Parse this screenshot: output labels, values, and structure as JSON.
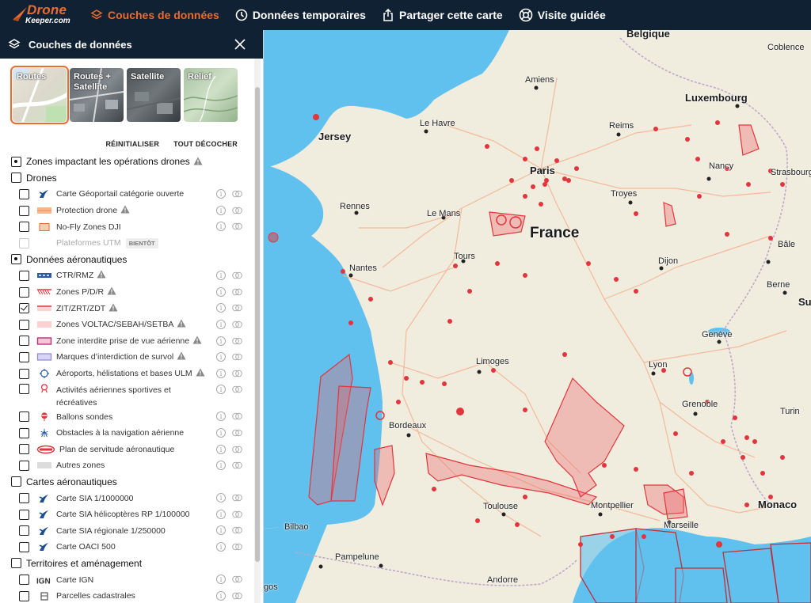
{
  "nav": {
    "logo_main": "Drone",
    "logo_sub": "Keeper.com",
    "items": [
      {
        "label": "Couches de données",
        "icon": "layers-icon",
        "active": true
      },
      {
        "label": "Données temporaires",
        "icon": "clock-icon",
        "active": false
      },
      {
        "label": "Partager cette carte",
        "icon": "share-icon",
        "active": false
      },
      {
        "label": "Visite guidée",
        "icon": "lifebuoy-icon",
        "active": false
      }
    ]
  },
  "panel": {
    "title": "Couches de données",
    "basemaps": [
      {
        "label": "Routes",
        "selected": true
      },
      {
        "label": "Routes + Satellite",
        "selected": false
      },
      {
        "label": "Satellite",
        "selected": false
      },
      {
        "label": "Relief",
        "selected": false
      }
    ],
    "reset_label": "RÉINITIALISER",
    "uncheck_all_label": "TOUT DÉCOCHER",
    "sections": [
      {
        "label": "Zones impactant les opérations drones",
        "state": "partial",
        "warn": true,
        "items": []
      },
      {
        "label": "Drones",
        "state": "off",
        "items": [
          {
            "label": "Carte Géoportail catégorie ouverte",
            "symbol": "plane-icon"
          },
          {
            "label": "Protection drone",
            "symbol": "orange-band",
            "warn": true
          },
          {
            "label": "No-Fly Zones DJI",
            "symbol": "orange-square"
          },
          {
            "label": "Plateformes UTM",
            "symbol": "none",
            "disabled": true,
            "tag": "BIENTÔT"
          }
        ]
      },
      {
        "label": "Données aéronautiques",
        "state": "partial",
        "items": [
          {
            "label": "CTR/RMZ",
            "symbol": "blue-dash",
            "warn": true
          },
          {
            "label": "Zones P/D/R",
            "symbol": "red-hatch",
            "warn": true
          },
          {
            "label": "ZIT/ZRT/ZDT",
            "symbol": "red-line",
            "warn": true,
            "checked": true
          },
          {
            "label": "Zones VOLTAC/SEBAH/SETBA",
            "symbol": "pink-fill",
            "warn": true
          },
          {
            "label": "Zone interdite prise de vue aérienne",
            "symbol": "magenta-box",
            "warn": true
          },
          {
            "label": "Marques d’interdiction de survol",
            "symbol": "lavender-box",
            "warn": true
          },
          {
            "label": "Aéroports, hélistations et bases ULM",
            "symbol": "airport-icon",
            "warn": true
          },
          {
            "label": "Activités aériennes sportives et récréatives",
            "symbol": "pin-icon",
            "tall": true
          },
          {
            "label": "Ballons sondes",
            "symbol": "balloon-icon"
          },
          {
            "label": "Obstacles à la navigation aérienne",
            "symbol": "obstacle-icon"
          },
          {
            "label": "Plan de servitude aéronautique",
            "symbol": "servitude-icon"
          },
          {
            "label": "Autres zones",
            "symbol": "gray-box"
          }
        ]
      },
      {
        "label": "Cartes aéronautiques",
        "state": "off",
        "items": [
          {
            "label": "Carte SIA 1/1000000",
            "symbol": "plane-icon"
          },
          {
            "label": "Carte SIA hélicoptères RP 1/100000",
            "symbol": "plane-icon"
          },
          {
            "label": "Carte SIA régionale 1/250000",
            "symbol": "plane-icon"
          },
          {
            "label": "Carte OACI 500",
            "symbol": "plane-icon"
          }
        ]
      },
      {
        "label": "Territoires et aménagement",
        "state": "off",
        "items": [
          {
            "label": "Carte IGN",
            "symbol": "ign-logo"
          },
          {
            "label": "Parcelles cadastrales",
            "symbol": "cadastre-icon"
          }
        ]
      }
    ]
  },
  "map": {
    "country_label": "France",
    "labels": [
      "Belgique",
      "Coblence",
      "Amiens",
      "Luxembourg",
      "Jersey",
      "Le Havre",
      "Reims",
      "Paris",
      "Nancy",
      "Strasbourg",
      "Troyes",
      "Rennes",
      "Le Mans",
      "Tours",
      "Dijon",
      "Bâle",
      "Nantes",
      "Berne",
      "Su",
      "Genève",
      "Limoges",
      "Lyon",
      "Grenoble",
      "Turin",
      "Bordeaux",
      "Montpellier",
      "Toulouse",
      "Monaco",
      "Marseille",
      "Bilbao",
      "Pampelune",
      "Andorre",
      "gos"
    ],
    "colors": {
      "water": "#60c1ef",
      "land": "#f0ecde",
      "zone_stroke": "#e2353d",
      "zone_fill": "#f2a2a4"
    }
  }
}
